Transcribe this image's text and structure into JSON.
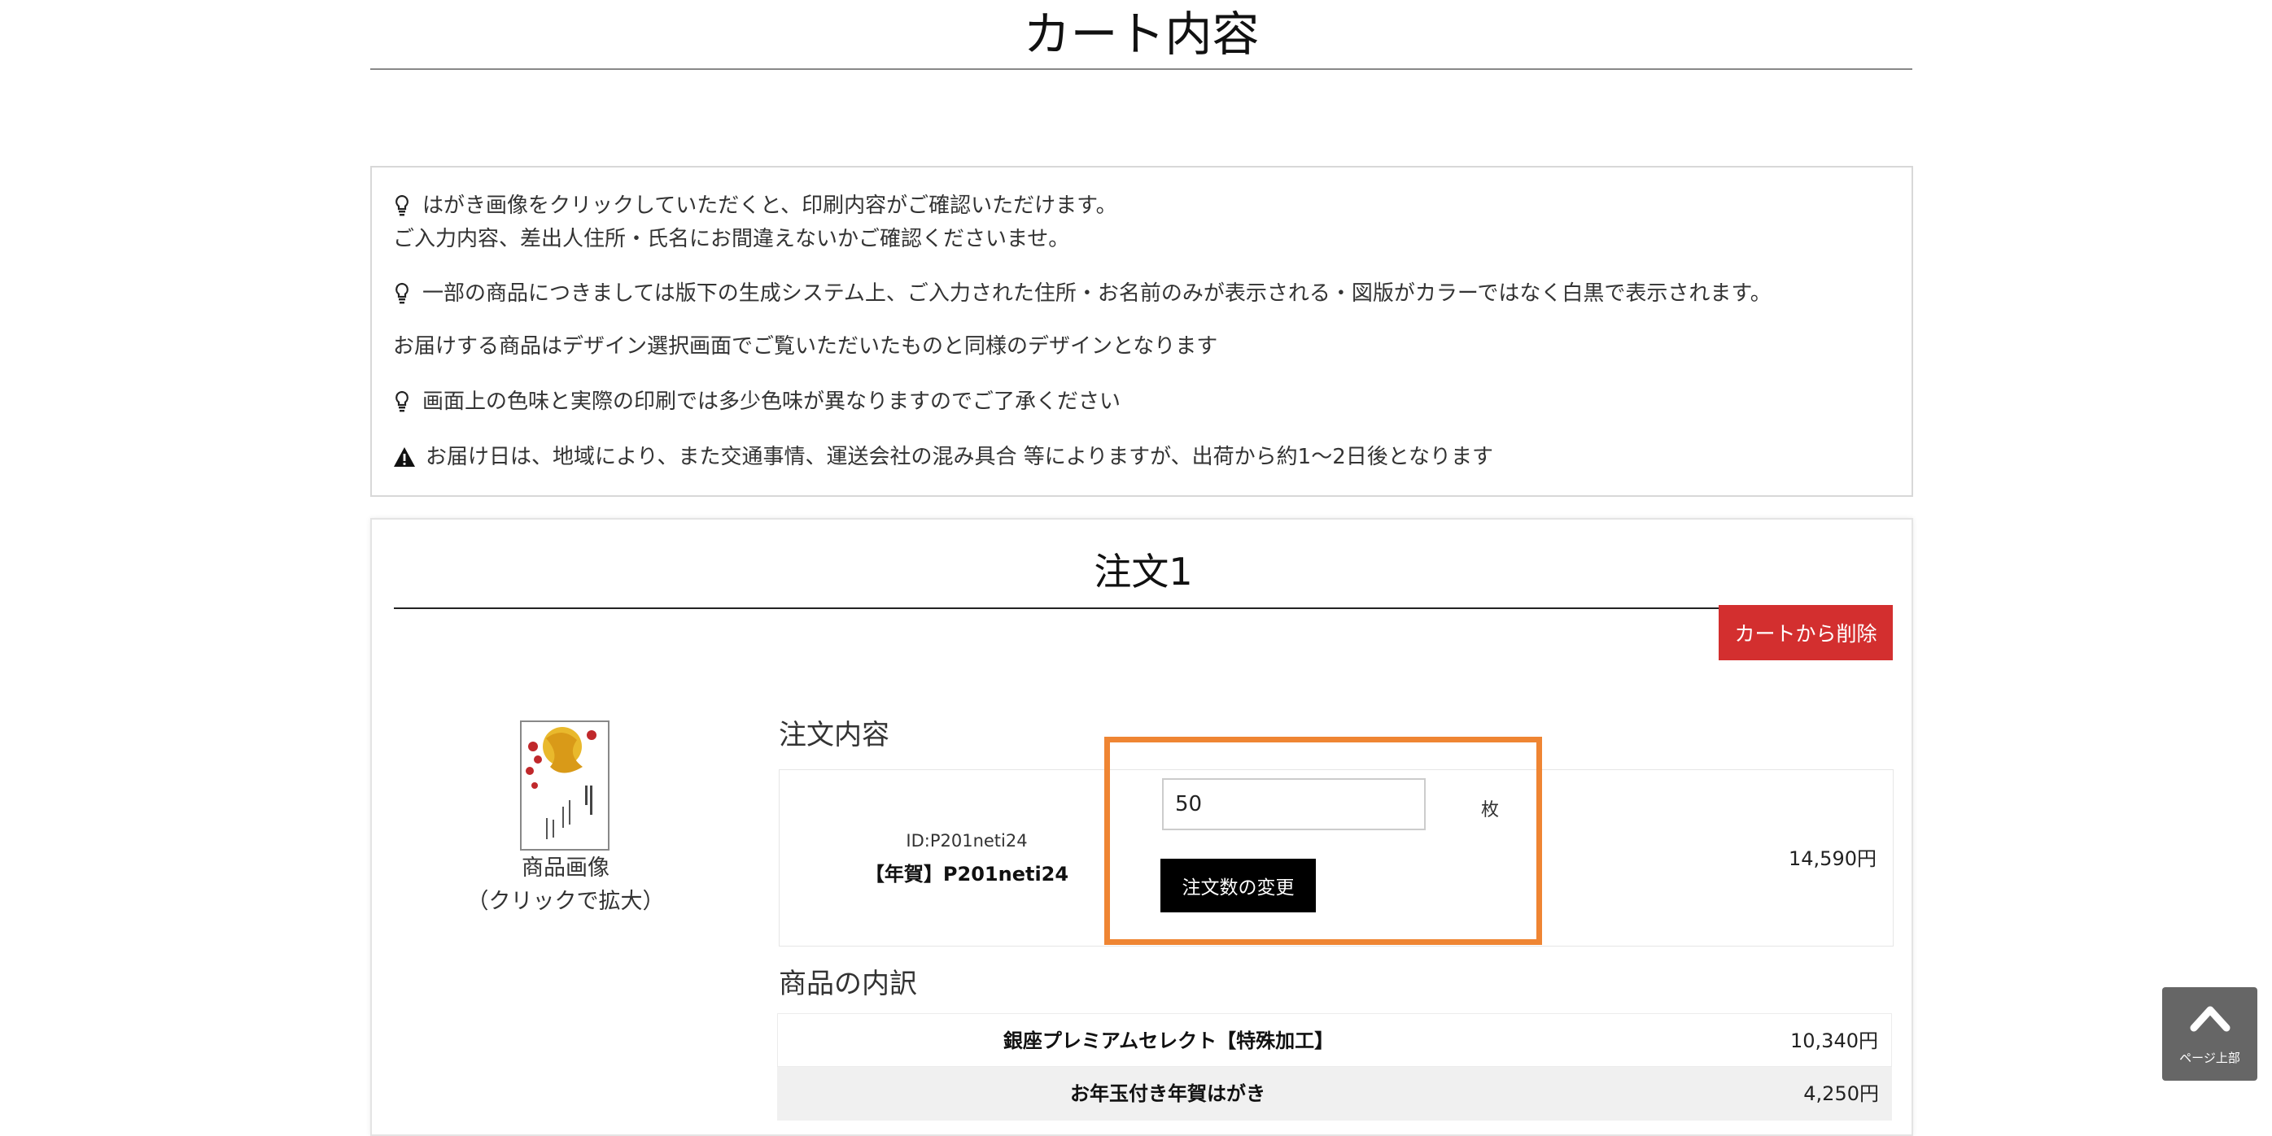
{
  "page": {
    "title": "カート内容"
  },
  "notices": [
    {
      "icon": "lightbulb-icon",
      "lines": [
        "はがき画像をクリックしていただくと、印刷内容がご確認いただけます。",
        "ご入力内容、差出人住所・氏名にお間違えないかご確認くださいませ。"
      ]
    },
    {
      "icon": "lightbulb-icon",
      "lines": [
        "一部の商品につきましては版下の生成システム上、ご入力された住所・お名前のみが表示される・図版がカラーではなく白黒で表示されます。"
      ]
    },
    {
      "icon": "",
      "lines": [
        "お届けする商品はデザイン選択画面でご覧いただいたものと同様のデザインとなります"
      ]
    },
    {
      "icon": "lightbulb-icon",
      "lines": [
        "画面上の色味と実際の印刷では多少色味が異なりますのでご了承ください"
      ]
    },
    {
      "icon": "warning-icon",
      "lines": [
        "お届け日は、地域により、また交通事情、運送会社の混み具合 等によりますが、出荷から約1～2日後となります"
      ]
    }
  ],
  "order": {
    "title": "注文1",
    "remove_label": "カートから削除",
    "thumbnail_caption_1": "商品画像",
    "thumbnail_caption_2": "（クリックで拡大）",
    "content_heading": "注文内容",
    "product_id": "ID:P201neti24",
    "product_name": "【年賀】P201neti24",
    "quantity": "50",
    "quantity_unit": "枚",
    "change_label": "注文数の変更",
    "price": "14,590円",
    "breakdown_heading": "商品の内訳",
    "breakdown": [
      {
        "name": "銀座プレミアムセレクト【特殊加工】",
        "price": "10,340円"
      },
      {
        "name": "お年玉付き年賀はがき",
        "price": "4,250円"
      }
    ]
  },
  "to_top": {
    "label": "ページ上部"
  },
  "colors": {
    "accent_red": "#d32f2f",
    "highlight_orange": "#ef8533",
    "button_black": "#000000"
  }
}
